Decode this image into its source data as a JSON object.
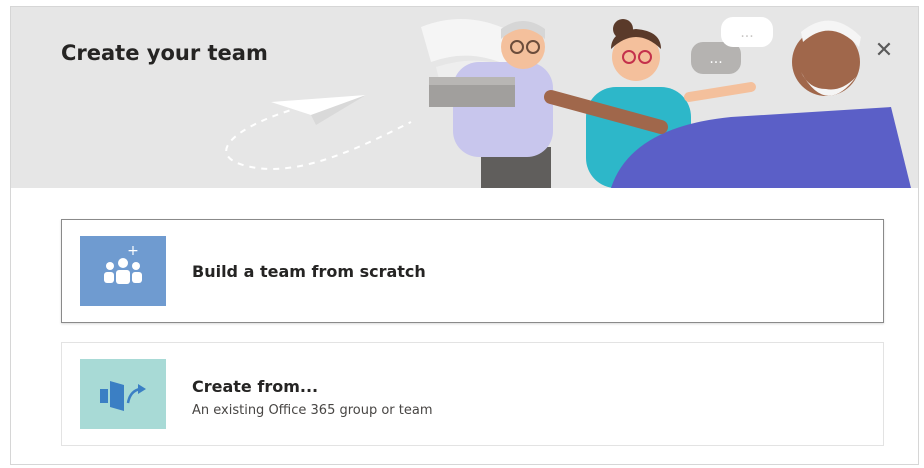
{
  "dialog": {
    "title": "Create your team",
    "close_icon": "close-icon"
  },
  "options": [
    {
      "title": "Build a team from scratch",
      "icon": "team-add-icon",
      "tile_color": "#6f9bd0"
    },
    {
      "title": "Create from...",
      "subtitle": "An existing Office 365 group or team",
      "icon": "create-from-icon",
      "tile_color": "#a8dad6"
    }
  ],
  "colors": {
    "header_bg": "#e6e6e6",
    "accent_purple": "#5b5fc7"
  }
}
